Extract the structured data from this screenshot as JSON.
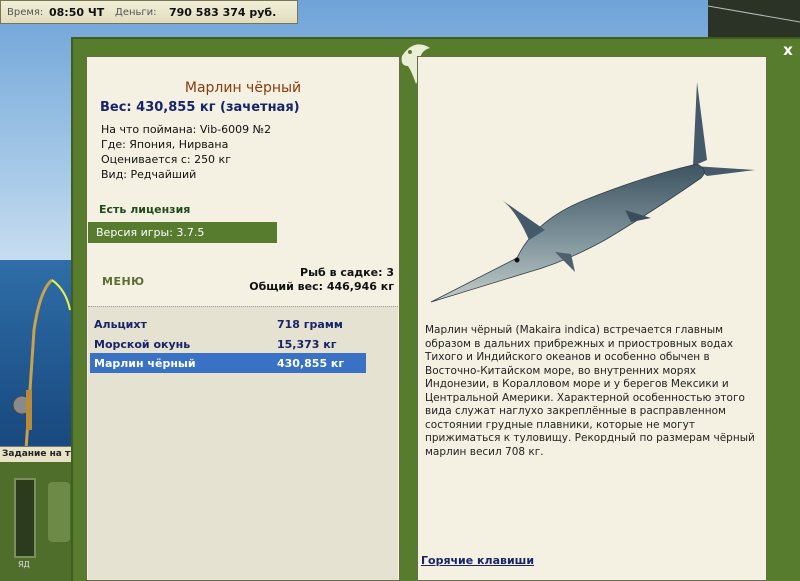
{
  "topbar": {
    "time_label": "Время:",
    "time_value": "08:50 ЧТ",
    "money_label": "Деньги:",
    "money_value": "790 583 374 руб."
  },
  "left_bottom": {
    "task_label": "Задание на тур",
    "gauge_label": "ЯД"
  },
  "window": {
    "close_label": "x"
  },
  "fish": {
    "title": "Марлин чёрный",
    "weight": "Вес: 430,855 кг (зачетная)",
    "details": [
      "На что поймана: Vib-6009 №2",
      "Где: Япония, Нирвана",
      "Оценивается с: 250 кг",
      "Вид: Редчайший"
    ],
    "license": "Есть лицензия",
    "version": "Версия игры: 3.7.5",
    "menu": "МЕНЮ",
    "keep_count": "Рыб в садке: 3",
    "keep_weight": "Общий вес: 446,946 кг",
    "description": "Марлин чёрный (Makaira indica) встречается главным образом в дальних прибрежных и приостровных водах Тихого и Индийского океанов и особенно обычен в Восточно-Китайском море, во внутренних морях Индонезии, в Коралловом море и у берегов Мексики и Центральной Америки. Характерной особенностью этого вида служат наглухо закреплённые в расправленном состоянии грудные плавники, которые не могут прижиматься к туловищу. Рекордный по размерам чёрный марлин весил 708 кг.",
    "hotkeys": "Горячие клавиши"
  },
  "catch_list": [
    {
      "name": "Альцихт",
      "weight": "718 грамм"
    },
    {
      "name": "Морской окунь",
      "weight": "15,373 кг"
    },
    {
      "name": "Марлин чёрный",
      "weight": "430,855 кг"
    }
  ],
  "colors": {
    "frame_green": "#587c2e",
    "panel_bg": "#f4f1e2",
    "title_brown": "#8a3b10",
    "text_blue": "#17246a",
    "selection": "#3971c4"
  },
  "icons": {
    "close": "close-icon",
    "logo": "fish-logo-icon"
  }
}
